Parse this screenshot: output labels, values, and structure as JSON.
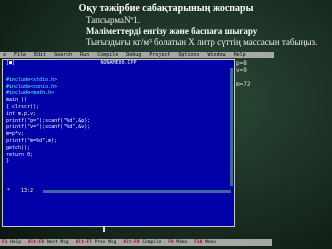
{
  "slide": {
    "title": "Оқу тәжірбие сабақтарының жоспары",
    "subtitle": "ТапсырмаNº1.",
    "line2": "Мәліметтерді енгізу және баспаға шығару",
    "line3": "Тығыздығы кг/м³ болатын Х литр сүттің массасын табыңыз."
  },
  "ide": {
    "menu": {
      "icon": "≡",
      "items": [
        "File",
        "Edit",
        "Search",
        "Run",
        "Compile",
        "Debug",
        "Project",
        "Options",
        "Window",
        "Help"
      ]
    },
    "window": {
      "close": "[■]",
      "title": "NONAME00.CPP"
    },
    "code": [
      "#include<stdio.h>",
      "#include<conio.h>",
      "#include<math.h>",
      "main ()",
      "{ clrscr();",
      "int m,p,v;",
      "printf(\"p=\");scanf(\"%d\",&p);",
      "printf(\"v=\");scanf(\"%d\",&v);",
      "m=p*v;",
      "printf(\"m=%d\",m);",
      "getch();",
      "return 0;",
      "}"
    ],
    "cursor_pos": "13:2",
    "modified": "*",
    "output": [
      "p=8",
      "v=9",
      "",
      "m=72"
    ],
    "status": [
      {
        "key": "F1",
        "label": "Help"
      },
      {
        "key": "Alt-F8",
        "label": "Next Msg"
      },
      {
        "key": "Alt-F7",
        "label": "Prev Msg"
      },
      {
        "key": "Alt-F9",
        "label": "Compile"
      },
      {
        "key": "F9",
        "label": "Make"
      },
      {
        "key": "F10",
        "label": "Menu"
      }
    ]
  }
}
